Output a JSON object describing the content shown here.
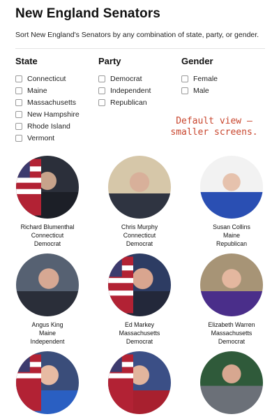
{
  "header": {
    "title": "New England Senators",
    "subtitle": "Sort New England's Senators by any combination of state, party, or gender."
  },
  "filters": {
    "state": {
      "heading": "State",
      "options": [
        "Connecticut",
        "Maine",
        "Massachusetts",
        "New Hampshire",
        "Rhode Island",
        "Vermont"
      ]
    },
    "party": {
      "heading": "Party",
      "options": [
        "Democrat",
        "Independent",
        "Republican"
      ]
    },
    "gender": {
      "heading": "Gender",
      "options": [
        "Female",
        "Male"
      ]
    }
  },
  "note": {
    "line1": "Default view –",
    "line2": "smaller screens."
  },
  "senators": [
    {
      "name": "Richard Blumenthal",
      "state": "Connecticut",
      "party": "Democrat"
    },
    {
      "name": "Chris Murphy",
      "state": "Connecticut",
      "party": "Democrat"
    },
    {
      "name": "Susan Collins",
      "state": "Maine",
      "party": "Republican"
    },
    {
      "name": "Angus King",
      "state": "Maine",
      "party": "Independent"
    },
    {
      "name": "Ed Markey",
      "state": "Massachusetts",
      "party": "Democrat"
    },
    {
      "name": "Elizabeth Warren",
      "state": "Massachusetts",
      "party": "Democrat"
    },
    {
      "name": "",
      "state": "",
      "party": ""
    },
    {
      "name": "",
      "state": "",
      "party": ""
    },
    {
      "name": "",
      "state": "",
      "party": ""
    }
  ]
}
